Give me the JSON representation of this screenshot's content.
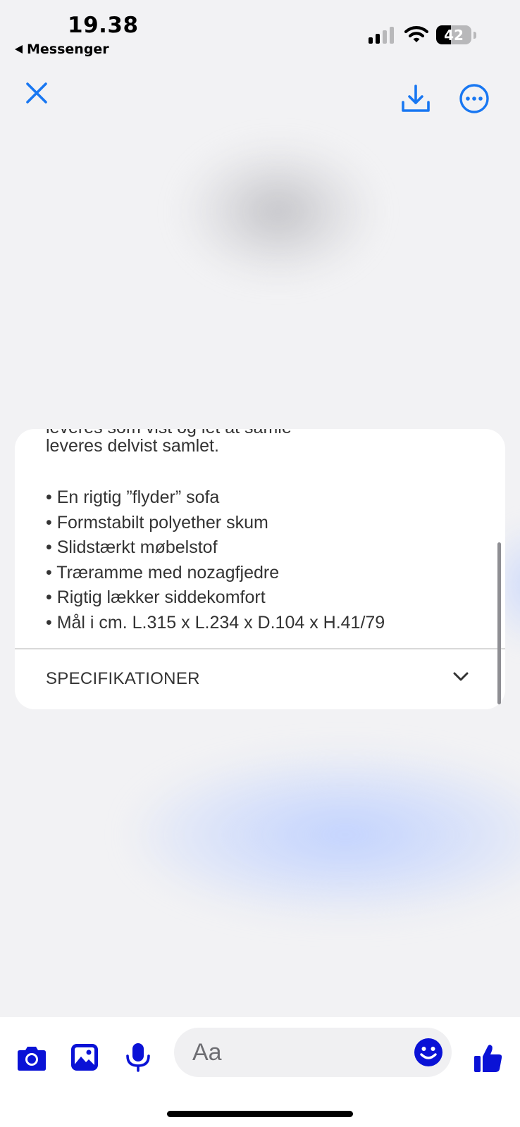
{
  "status_bar": {
    "time": "19.38",
    "back_label": "Messenger",
    "battery_level": "42",
    "battery_fraction": 0.42,
    "signal_bars_active": 2,
    "signal_bars_total": 4
  },
  "top_bar": {
    "close_icon": "close-icon",
    "download_icon": "download-icon",
    "more_icon": "more-options-icon"
  },
  "product_card": {
    "cut_off_line": "leveres som vist og let at samle",
    "intro_line": "leveres delvist samlet.",
    "bullets": [
      "• En rigtig ”flyder” sofa",
      "• Formstabilt polyether skum",
      "• Slidstærkt møbelstof",
      "• Træramme med nozagfjedre",
      "• Rigtig lækker siddekomfort",
      "• Mål i cm. L.315 x L.234 x D.104 x H.41/79"
    ],
    "section_label": "SPECIFIKATIONER",
    "section_icon": "chevron-down-icon"
  },
  "composer": {
    "message_placeholder": "Aa",
    "icons": [
      "camera-icon",
      "gallery-icon",
      "microphone-icon",
      "emoji-icon",
      "thumbs-up-icon"
    ]
  },
  "colors": {
    "accent_blue": "#1877f2",
    "composer_blue": "#0a12d6",
    "background": "#f2f2f4",
    "card": "#ffffff",
    "text": "#333333"
  }
}
